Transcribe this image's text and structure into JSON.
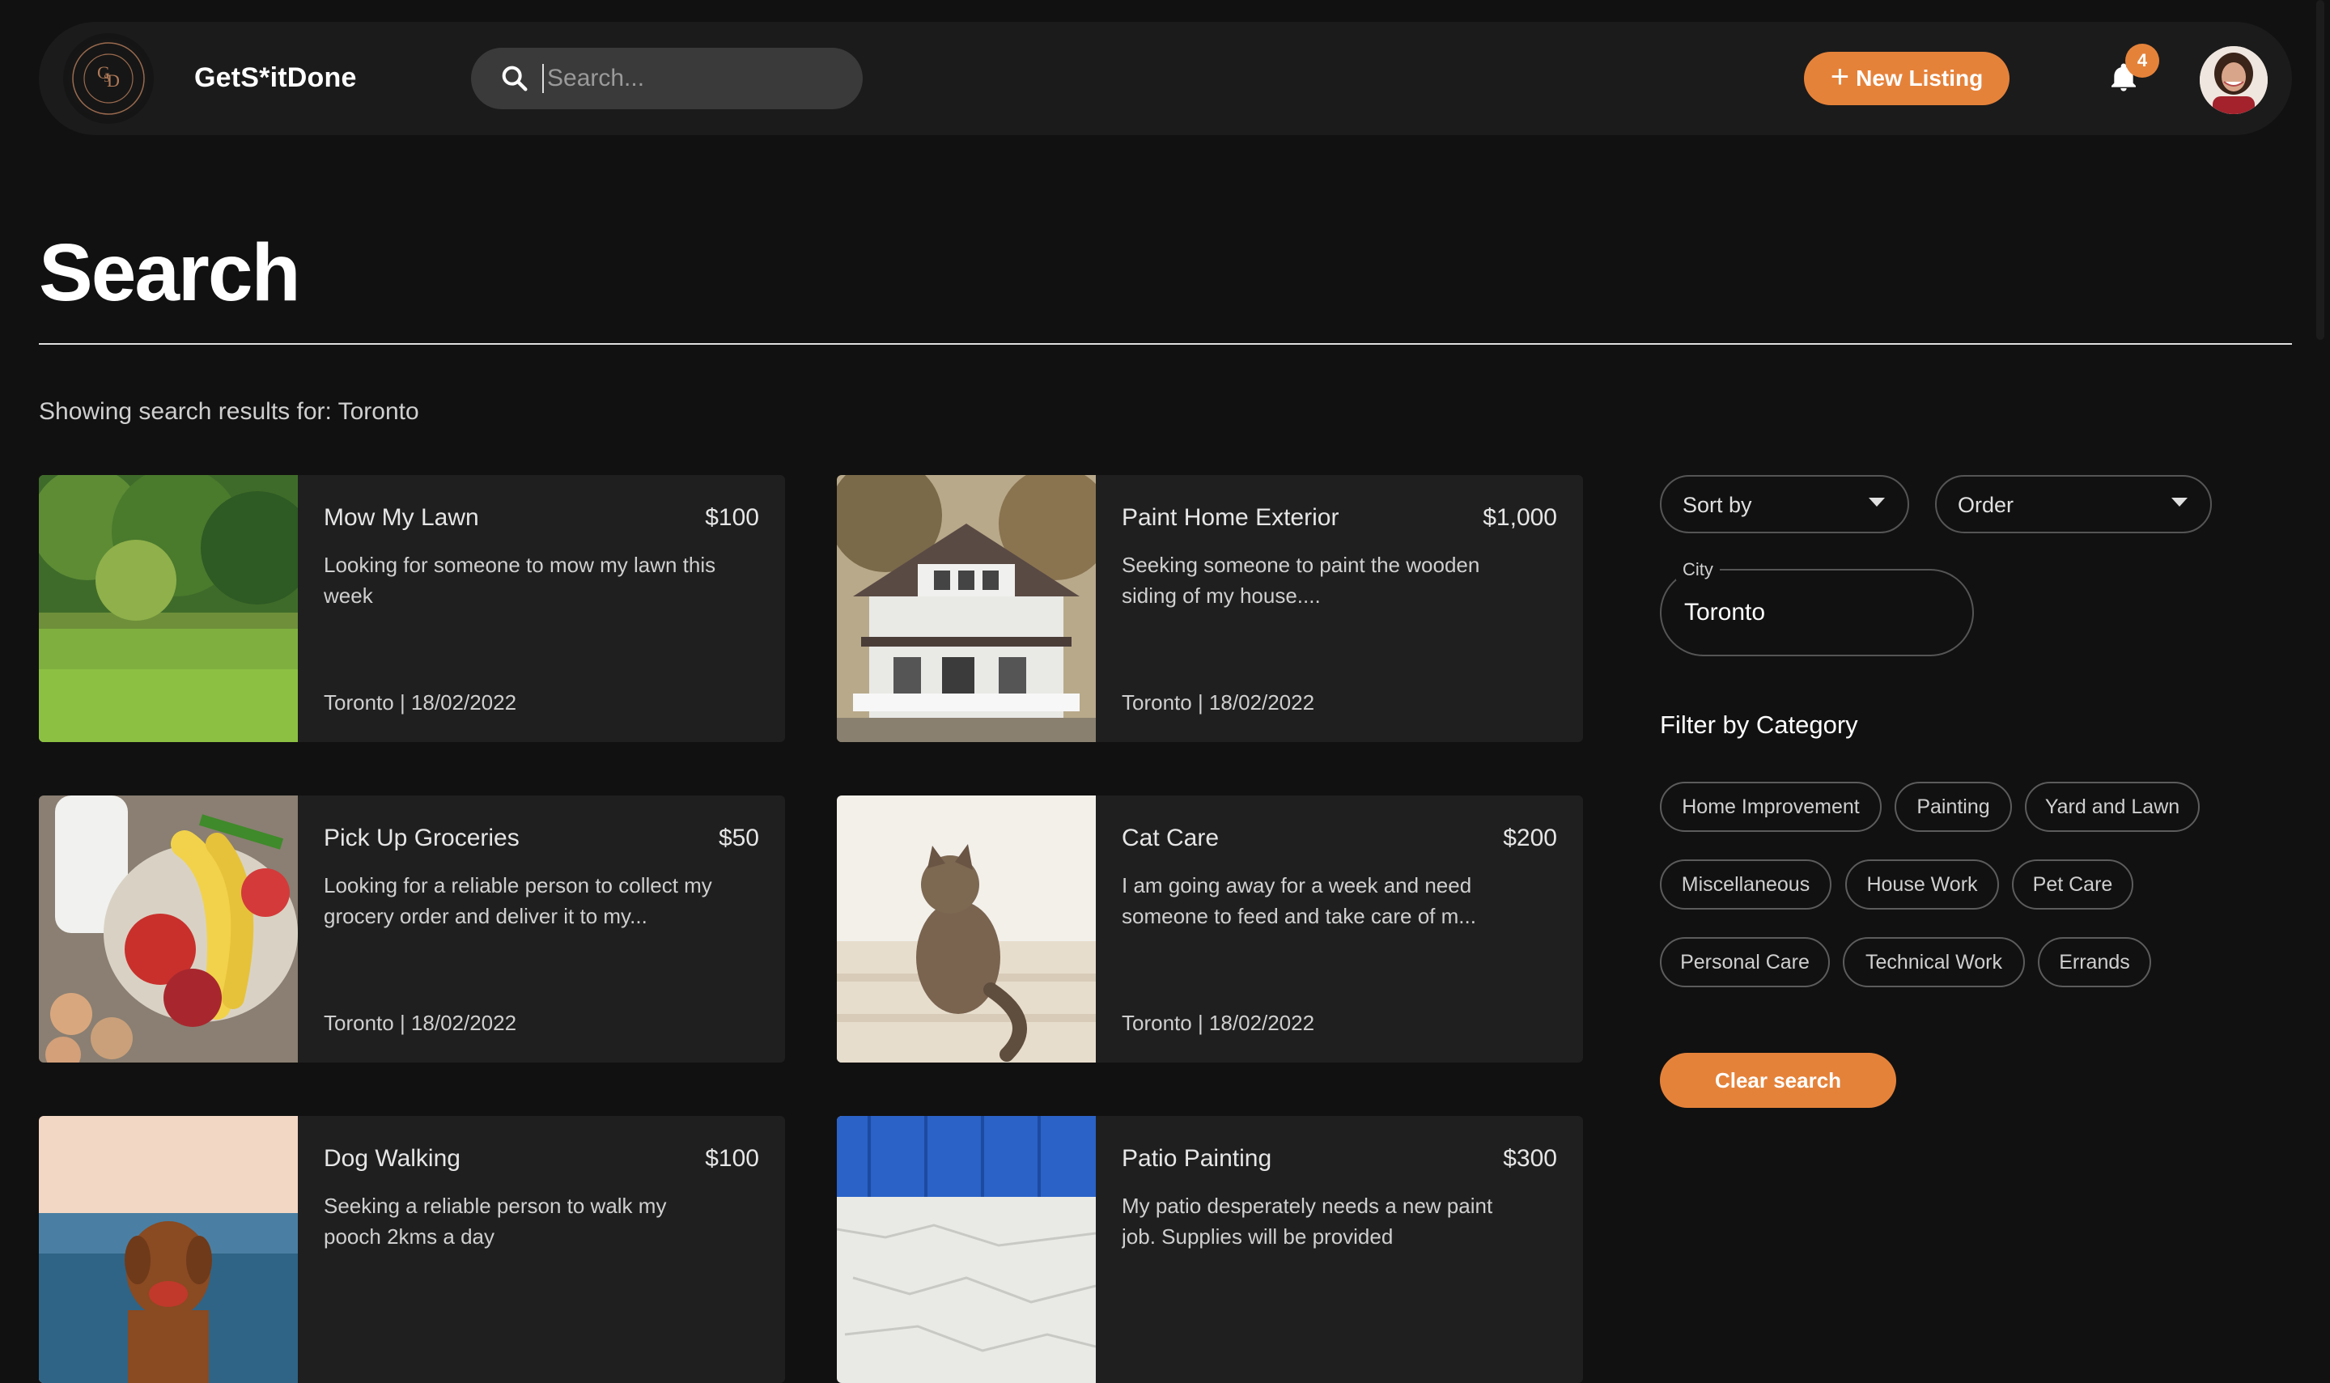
{
  "header": {
    "brand": "GetS*itDone",
    "search_placeholder": "Search...",
    "new_listing_label": "New Listing",
    "notification_count": "4"
  },
  "page": {
    "title": "Search",
    "results_text": "Showing search results for: Toronto"
  },
  "listings": [
    {
      "title": "Mow My Lawn",
      "price": "$100",
      "description": "Looking for someone to mow my lawn this week",
      "meta": "Toronto | 18/02/2022"
    },
    {
      "title": "Paint Home Exterior",
      "price": "$1,000",
      "description": "Seeking someone to paint the wooden siding of my house....",
      "meta": "Toronto | 18/02/2022"
    },
    {
      "title": "Pick Up Groceries",
      "price": "$50",
      "description": "Looking for a reliable person to collect my grocery order and deliver it to my...",
      "meta": "Toronto | 18/02/2022"
    },
    {
      "title": "Cat Care",
      "price": "$200",
      "description": "I am going away for a week and need someone to feed and take care of m...",
      "meta": "Toronto | 18/02/2022"
    },
    {
      "title": "Dog Walking",
      "price": "$100",
      "description": "Seeking a reliable person to walk my pooch 2kms a day",
      "meta": ""
    },
    {
      "title": "Patio Painting",
      "price": "$300",
      "description": "My patio desperately needs a new paint job. Supplies will be provided",
      "meta": ""
    }
  ],
  "filters": {
    "sort_label": "Sort by",
    "order_label": "Order",
    "city_label": "City",
    "city_value": "Toronto",
    "category_heading": "Filter by Category",
    "categories": [
      "Home Improvement",
      "Painting",
      "Yard and Lawn",
      "Miscellaneous",
      "House Work",
      "Pet Care",
      "Personal Care",
      "Technical Work",
      "Errands"
    ],
    "clear_label": "Clear search"
  },
  "colors": {
    "accent": "#e5823a",
    "background": "#111111",
    "card": "#1f1f1f"
  }
}
